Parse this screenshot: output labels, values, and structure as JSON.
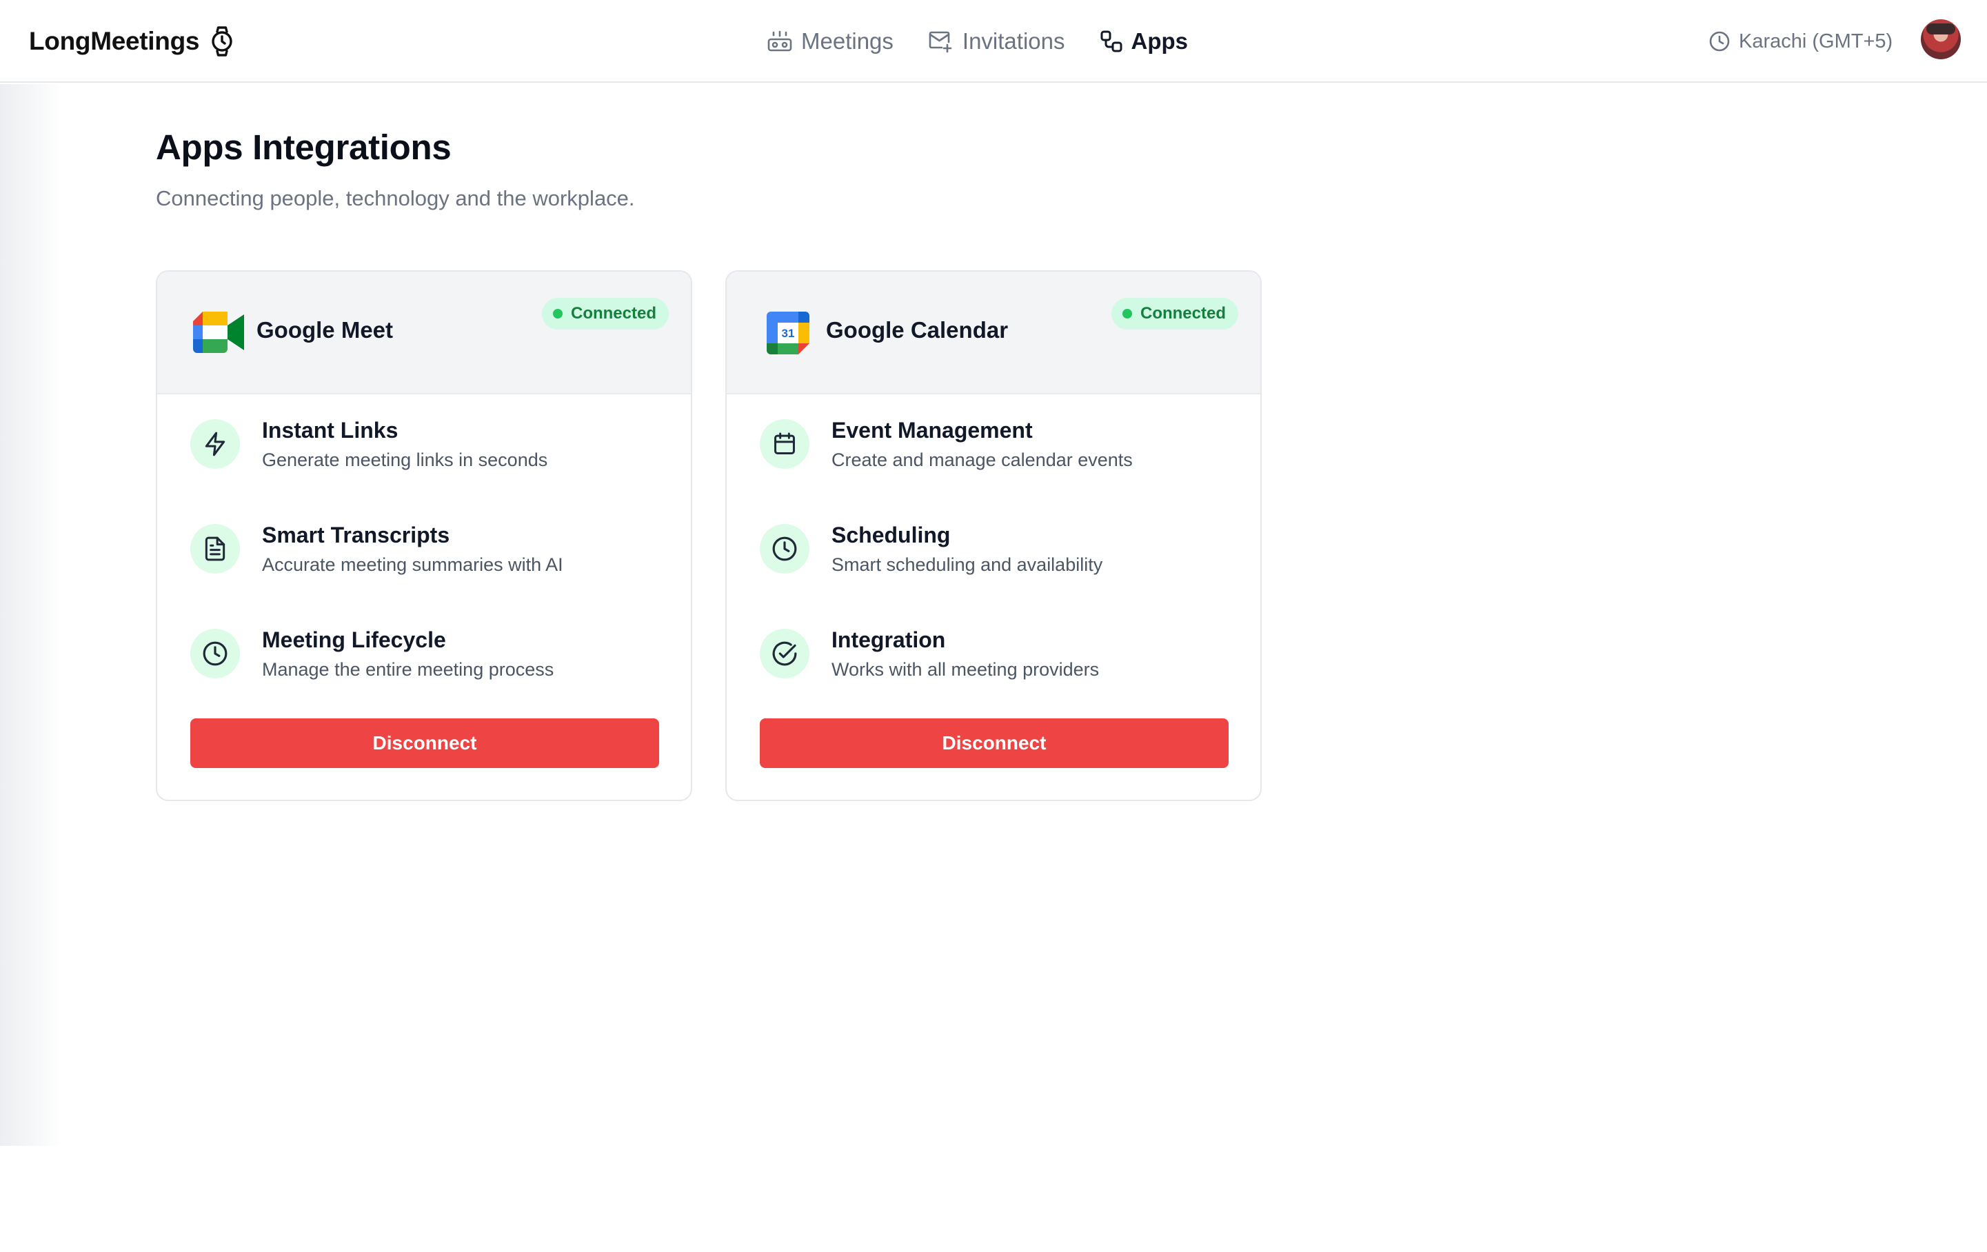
{
  "brand": {
    "name": "LongMeetings",
    "icon": "watch-icon"
  },
  "nav": [
    {
      "label": "Meetings",
      "icon": "meetings-icon",
      "active": false
    },
    {
      "label": "Invitations",
      "icon": "mail-icon",
      "active": false
    },
    {
      "label": "Apps",
      "icon": "apps-icon",
      "active": true
    }
  ],
  "timezone": {
    "label": "Karachi (GMT+5)",
    "icon": "clock-icon"
  },
  "page": {
    "title": "Apps Integrations",
    "subtitle": "Connecting people, technology and the workplace."
  },
  "cards": [
    {
      "name": "Google Meet",
      "logo": "google-meet-logo",
      "status": "Connected",
      "features": [
        {
          "icon": "lightning-icon",
          "title": "Instant Links",
          "description": "Generate meeting links in seconds"
        },
        {
          "icon": "document-icon",
          "title": "Smart Transcripts",
          "description": "Accurate meeting summaries with AI"
        },
        {
          "icon": "clock-icon",
          "title": "Meeting Lifecycle",
          "description": "Manage the entire meeting process"
        }
      ],
      "action_label": "Disconnect"
    },
    {
      "name": "Google Calendar",
      "logo": "google-calendar-logo",
      "logo_text": "31",
      "status": "Connected",
      "features": [
        {
          "icon": "calendar-icon",
          "title": "Event Management",
          "description": "Create and manage calendar events"
        },
        {
          "icon": "clock-icon",
          "title": "Scheduling",
          "description": "Smart scheduling and availability"
        },
        {
          "icon": "check-circle-icon",
          "title": "Integration",
          "description": "Works with all meeting providers"
        }
      ],
      "action_label": "Disconnect"
    }
  ],
  "colors": {
    "danger": "#ef4444",
    "success_bg": "#d1fae5",
    "success_text": "#15803d",
    "success_dot": "#22c55e",
    "icon_bg": "#dcfce7"
  }
}
